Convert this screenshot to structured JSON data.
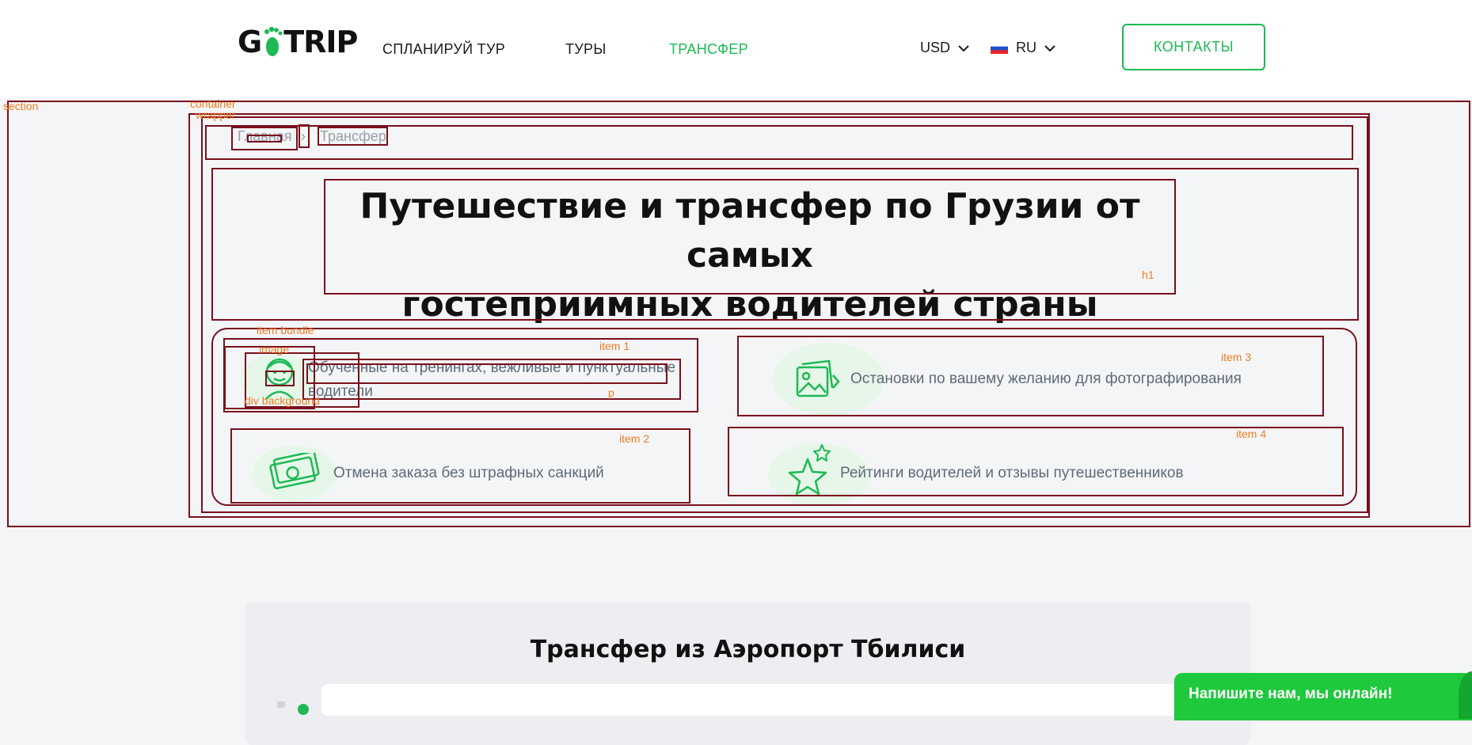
{
  "header": {
    "logo": {
      "left": "G",
      "right": "TRIP",
      "icon": "footprint-icon"
    },
    "nav": [
      {
        "label": "СПЛАНИРУЙ ТУР"
      },
      {
        "label": "ТУРЫ"
      },
      {
        "label": "ТРАНСФЕР",
        "active": true
      }
    ],
    "currency": "USD",
    "language": "RU",
    "contacts_label": "КОНТАКТЫ",
    "accent_color": "#1db954"
  },
  "breadcrumb": {
    "home": "Главная",
    "separator": "›",
    "current": "Трансфер"
  },
  "hero": {
    "title_line1": "Путешествие и трансфер по Грузии от самых",
    "title_line2": "гостеприимных водителей страны"
  },
  "features": [
    {
      "text": "Обученные на тренингах, вежливые и пунктуальные водители",
      "icon": "driver-face-icon"
    },
    {
      "text": "Остановки по вашему желанию для фотографирования",
      "icon": "photo-gallery-icon"
    },
    {
      "text": "Отмена заказа без штрафных санкций",
      "icon": "money-bills-icon"
    },
    {
      "text": "Рейтинги водителей и отзывы путешественников",
      "icon": "stars-icon"
    }
  ],
  "overlay_labels": {
    "section": "section",
    "container": "container",
    "wrapper": "wrapper",
    "h1": "h1",
    "item_bundle": "item bundle",
    "image": "image",
    "div_background": "div background",
    "p": "p",
    "item1": "item 1",
    "item2": "item 2",
    "item3": "item 3",
    "item4": "item 4"
  },
  "transfer_section": {
    "title": "Трансфер из Аэропорт Тбилиси"
  },
  "chat": {
    "label": "Напишите нам, мы онлайн!",
    "color": "#1ec93c"
  }
}
